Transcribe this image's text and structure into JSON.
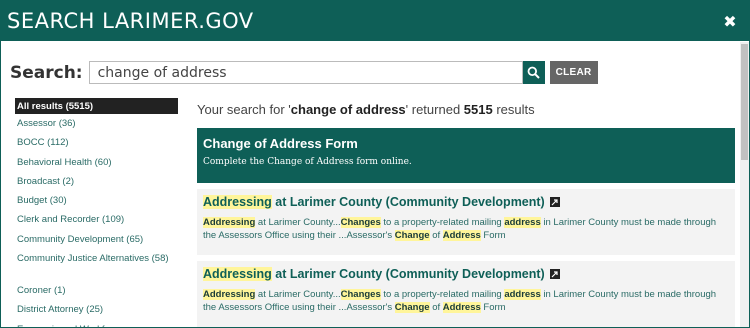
{
  "header": {
    "title": "SEARCH LARIMER.GOV",
    "close_symbol": "✖"
  },
  "search": {
    "label": "Search:",
    "value": "change of address",
    "clear_label": "CLEAR"
  },
  "sidebar": {
    "items": [
      {
        "label": "All results (5515)"
      },
      {
        "label": "Assessor (36)"
      },
      {
        "label": "BOCC (112)"
      },
      {
        "label": "Behavioral Health (60)"
      },
      {
        "label": "Broadcast (2)"
      },
      {
        "label": "Budget (30)"
      },
      {
        "label": "Clerk and Recorder (109)"
      },
      {
        "label": "Community Development (65)"
      },
      {
        "label": "Community Justice Alternatives (58)"
      },
      {
        "label": "Coroner (1)"
      },
      {
        "label": "District Attorney (25)"
      },
      {
        "label": "Economic and Workforce"
      }
    ]
  },
  "summary": {
    "prefix": "Your search for '",
    "query": "change of address",
    "middle": "' returned ",
    "count": "5515",
    "suffix": " results"
  },
  "featured": {
    "title": "Change of Address Form",
    "description": "Complete the Change of Address form online."
  },
  "results": [
    {
      "title_highlight": "Addressing",
      "title_rest": " at Larimer County (Community Development)",
      "s1": "Addressing",
      "s2": " at Larimer County...",
      "s3": "Changes",
      "s4": " to a property-related mailing ",
      "s5": "address",
      "s6": " in Larimer County must be made through the Assessors Office using their ...Assessor's ",
      "s7": "Change",
      "s8": " of ",
      "s9": "Address",
      "s10": " Form"
    },
    {
      "title_highlight": "Addressing",
      "title_rest": " at Larimer County (Community Development)",
      "s1": "Addressing",
      "s2": " at Larimer County...",
      "s3": "Changes",
      "s4": " to a property-related mailing ",
      "s5": "address",
      "s6": " in Larimer County must be made through the Assessors Office using their ...Assessor's ",
      "s7": "Change",
      "s8": " of ",
      "s9": "Address",
      "s10": " Form"
    }
  ],
  "colors": {
    "brand": "#0e5f57",
    "highlight": "#fff59a"
  }
}
